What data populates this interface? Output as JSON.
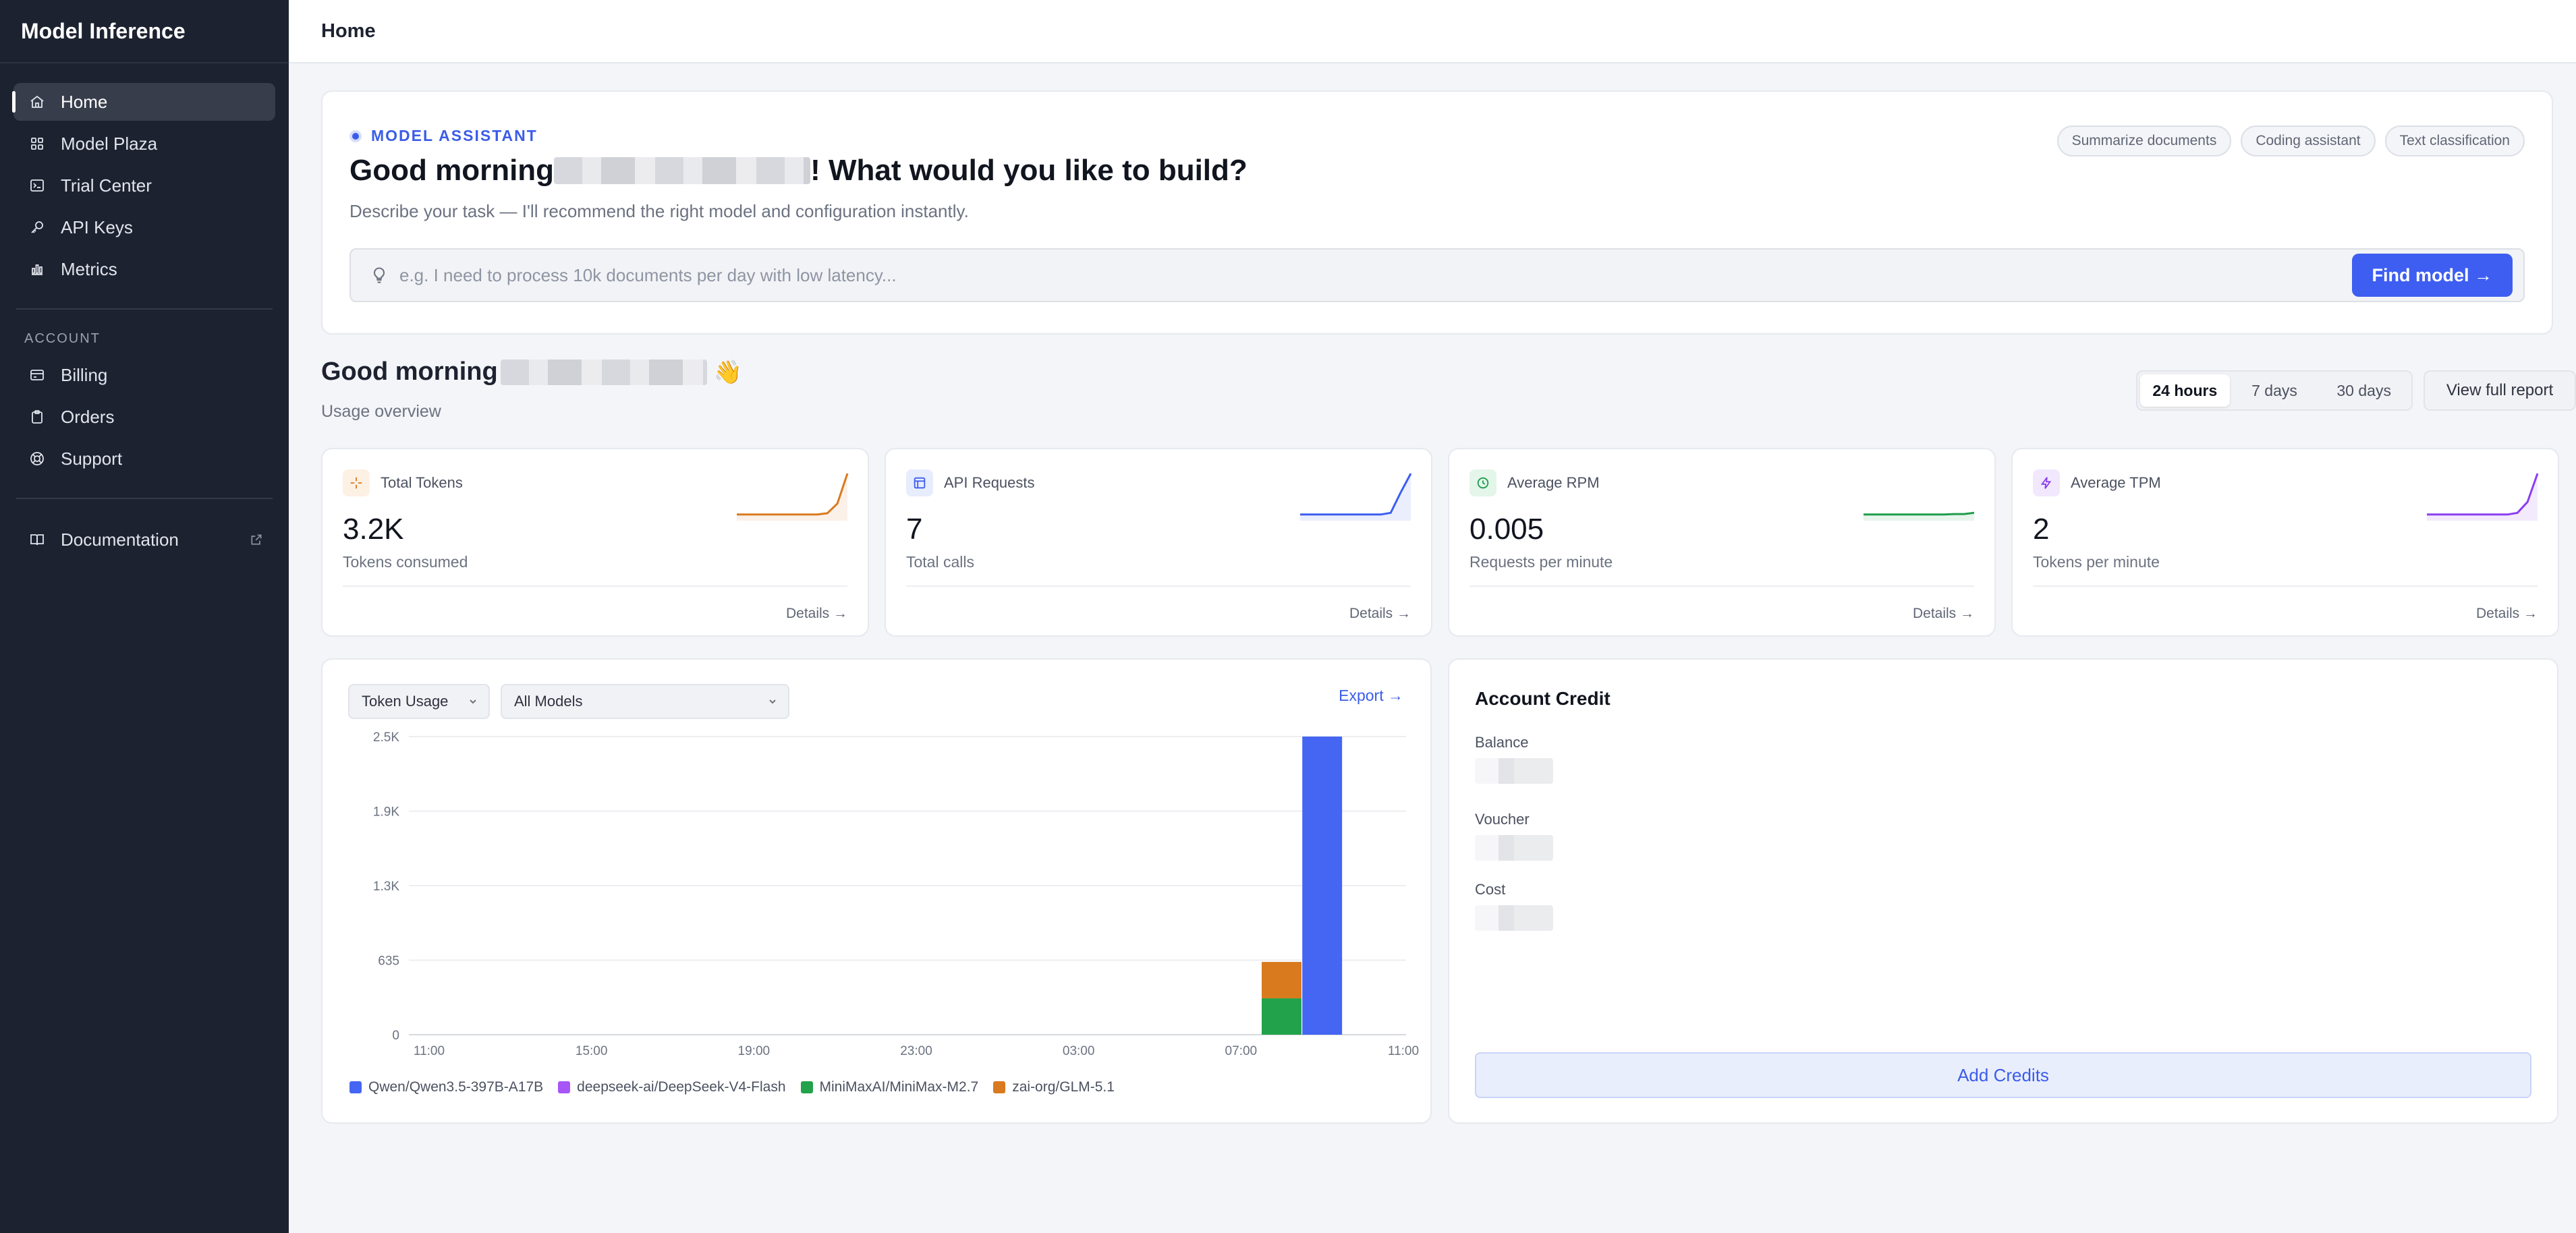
{
  "app": {
    "title": "Model Inference"
  },
  "sidebar": {
    "items": [
      {
        "label": "Home",
        "icon": "home-icon",
        "active": true
      },
      {
        "label": "Model Plaza",
        "icon": "grid-icon"
      },
      {
        "label": "Trial Center",
        "icon": "terminal-icon"
      },
      {
        "label": "API Keys",
        "icon": "key-icon"
      },
      {
        "label": "Metrics",
        "icon": "bar-chart-icon"
      }
    ],
    "account_heading": "ACCOUNT",
    "account_items": [
      {
        "label": "Billing",
        "icon": "credit-card-icon"
      },
      {
        "label": "Orders",
        "icon": "clipboard-icon"
      },
      {
        "label": "Support",
        "icon": "lifebuoy-icon"
      }
    ],
    "docs": {
      "label": "Documentation",
      "icon": "book-icon",
      "external_icon": "external-link-icon"
    }
  },
  "header": {
    "title": "Home"
  },
  "assistant": {
    "eyebrow": "MODEL ASSISTANT",
    "title_prefix": "Good morning",
    "title_suffix": "! What would you like to build?",
    "subtitle": "Describe your task — I'll recommend the right model and configuration instantly.",
    "chips": [
      "Summarize documents",
      "Coding assistant",
      "Text classification"
    ],
    "input_placeholder": "e.g. I need to process 10k documents per day with low latency...",
    "button_label": "Find model →"
  },
  "greeting": {
    "title": "Good morning",
    "emoji": "👋",
    "subtitle": "Usage overview"
  },
  "range": {
    "options": [
      "24 hours",
      "7 days",
      "30 days"
    ],
    "selected": "24 hours"
  },
  "report_button": "View full report",
  "stats": [
    {
      "title": "Total Tokens",
      "value": "3.2K",
      "label": "Tokens consumed",
      "link": "Details →",
      "color": "#d97a1e",
      "bg": "#fdf1e4",
      "icon": "sparkle-icon",
      "spark": [
        0.02,
        0.02,
        0.02,
        0.02,
        0.02,
        0.02,
        0.02,
        0.02,
        0.02,
        0.05,
        0.28,
        1.0
      ]
    },
    {
      "title": "API Requests",
      "value": "7",
      "label": "Total calls",
      "link": "Details →",
      "color": "#3d5ef0",
      "bg": "#e8edfd",
      "icon": "window-icon",
      "spark": [
        0.02,
        0.02,
        0.02,
        0.02,
        0.02,
        0.02,
        0.02,
        0.02,
        0.02,
        0.06,
        0.55,
        1.0
      ]
    },
    {
      "title": "Average RPM",
      "value": "0.005",
      "label": "Requests per minute",
      "link": "Details →",
      "color": "#1f9d4c",
      "bg": "#e4f5ea",
      "icon": "clock-icon",
      "spark": [
        0.02,
        0.02,
        0.02,
        0.02,
        0.02,
        0.02,
        0.02,
        0.02,
        0.02,
        0.03,
        0.03,
        0.06
      ]
    },
    {
      "title": "Average TPM",
      "value": "2",
      "label": "Tokens per minute",
      "link": "Details →",
      "color": "#8a3ff0",
      "bg": "#f1e8fd",
      "icon": "bolt-icon",
      "spark": [
        0.02,
        0.02,
        0.02,
        0.02,
        0.02,
        0.02,
        0.02,
        0.02,
        0.02,
        0.06,
        0.32,
        1.0
      ]
    }
  ],
  "usage_chart": {
    "metric_select": "Token Usage",
    "model_select": "All Models",
    "export_label": "Export →"
  },
  "chart_data": {
    "type": "bar",
    "stacked": true,
    "categories": [
      "08:00",
      "09:00"
    ],
    "x_ticks": [
      "11:00",
      "15:00",
      "19:00",
      "23:00",
      "03:00",
      "07:00",
      "11:00"
    ],
    "y_ticks": [
      "2.5K",
      "1.9K",
      "1.3K",
      "635",
      "0"
    ],
    "ylim": [
      0,
      2540
    ],
    "grid": true,
    "legend_position": "bottom-left",
    "series": [
      {
        "name": "Qwen/Qwen3.5-397B-A17B",
        "color": "#4466f2",
        "values": [
          0,
          2540
        ]
      },
      {
        "name": "deepseek-ai/DeepSeek-V4-Flash",
        "color": "#a855f7",
        "values": [
          0,
          0
        ]
      },
      {
        "name": "MiniMaxAI/MiniMax-M2.7",
        "color": "#22a24a",
        "values": [
          310,
          0
        ]
      },
      {
        "name": "zai-org/GLM-5.1",
        "color": "#d97a1e",
        "values": [
          310,
          0
        ]
      }
    ]
  },
  "credit": {
    "title": "Account Credit",
    "labels": [
      "Balance",
      "Voucher",
      "Cost"
    ],
    "button": "Add Credits"
  }
}
